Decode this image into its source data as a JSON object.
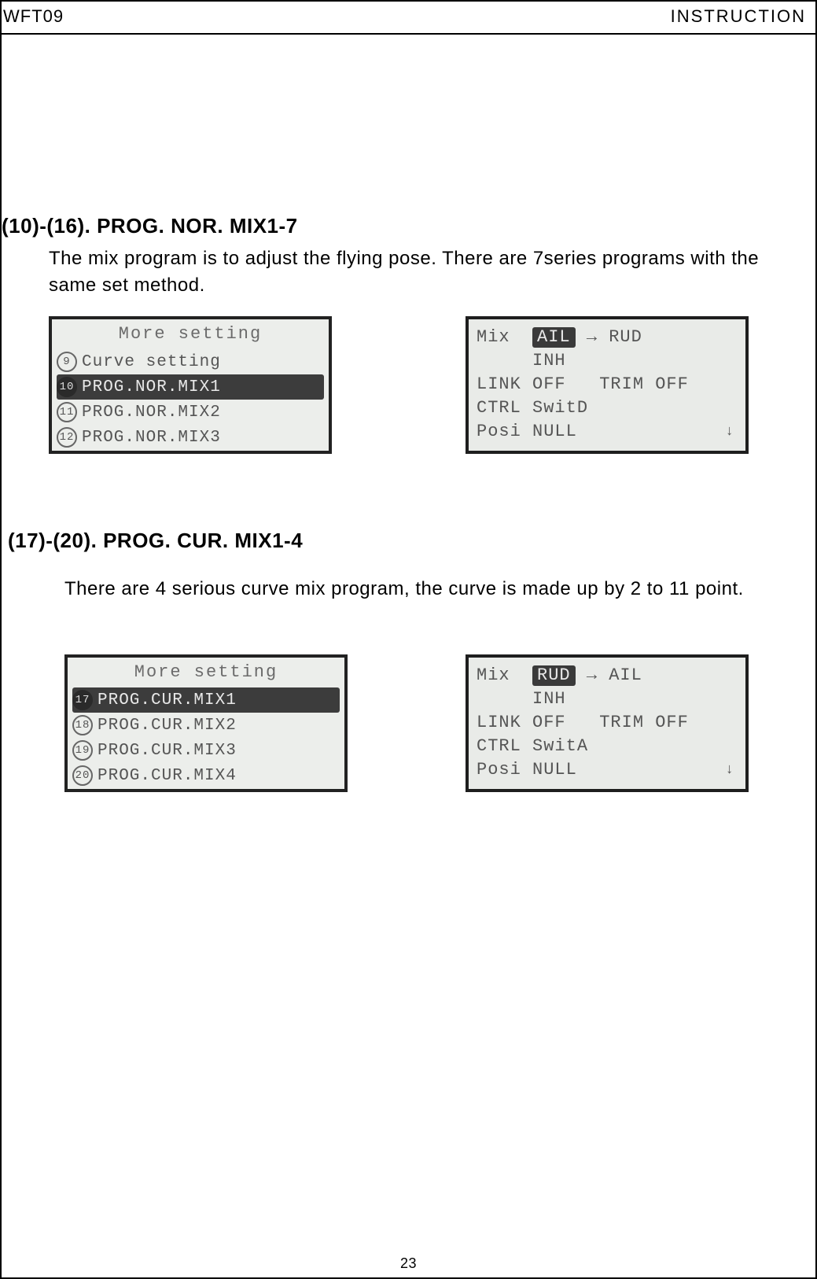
{
  "header": {
    "left": "WFT09",
    "right": "INSTRUCTION"
  },
  "footer": {
    "page": "23"
  },
  "sec1": {
    "title": "(10)-(16). PROG. NOR. MIX1-7",
    "body": "The mix program is to adjust the flying pose. There are 7series programs with the same set method."
  },
  "sec2": {
    "title": "(17)-(20). PROG. CUR. MIX1-4",
    "body": "There are 4 serious curve mix program, the curve is made up by 2 to 11 point."
  },
  "lcdA": {
    "title": "More setting",
    "rows": [
      {
        "num": "9",
        "txt": "Curve setting",
        "sel": false,
        "filled": false
      },
      {
        "num": "10",
        "txt": "PROG.NOR.MIX1",
        "sel": true,
        "filled": true
      },
      {
        "num": "11",
        "txt": "PROG.NOR.MIX2",
        "sel": false,
        "filled": false
      },
      {
        "num": "12",
        "txt": "PROG.NOR.MIX3",
        "sel": false,
        "filled": false
      }
    ]
  },
  "lcdB": {
    "l1_pre": "Mix  ",
    "pill": "AIL",
    "l1_post": " → RUD",
    "l2": "     INH",
    "l3": "LINK OFF   TRIM OFF",
    "l4": "CTRL SwitD",
    "l5": "Posi NULL",
    "arrow": "↓"
  },
  "lcdC": {
    "title": "More setting",
    "rows": [
      {
        "num": "17",
        "txt": "PROG.CUR.MIX1",
        "sel": true,
        "filled": true
      },
      {
        "num": "18",
        "txt": "PROG.CUR.MIX2",
        "sel": false,
        "filled": false
      },
      {
        "num": "19",
        "txt": "PROG.CUR.MIX3",
        "sel": false,
        "filled": false
      },
      {
        "num": "20",
        "txt": "PROG.CUR.MIX4",
        "sel": false,
        "filled": false
      }
    ]
  },
  "lcdD": {
    "l1_pre": "Mix  ",
    "pill": "RUD",
    "l1_post": " → AIL",
    "l2": "     INH",
    "l3": "LINK OFF   TRIM OFF",
    "l4": "CTRL SwitA",
    "l5": "Posi NULL",
    "arrow": "↓"
  }
}
